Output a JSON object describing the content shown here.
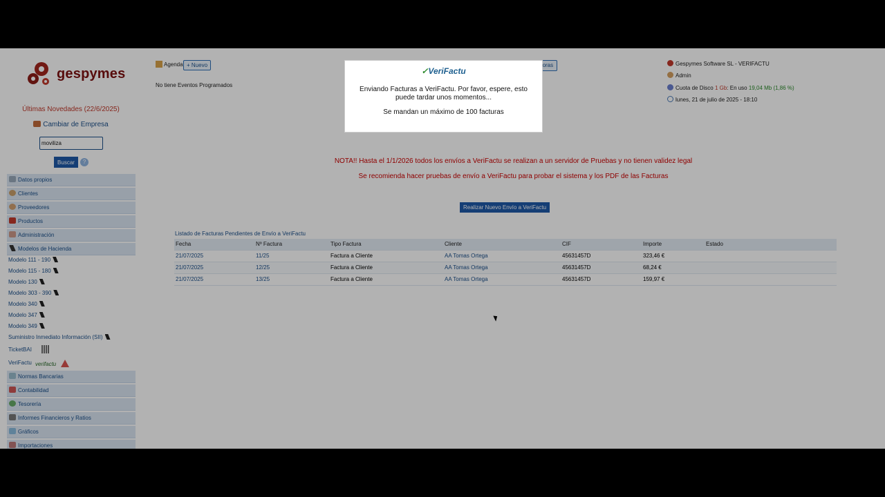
{
  "sidebar": {
    "logo_text": "gespymes",
    "novedades": "Últimas Novedades (22/6/2025)",
    "cambiar_empresa": "Cambiar de Empresa",
    "search_value": "moviliza",
    "buscar_label": "Buscar",
    "help_label": "?",
    "menu": [
      {
        "label": "Datos propios"
      },
      {
        "label": "Clientes"
      },
      {
        "label": "Proveedores"
      },
      {
        "label": "Productos"
      },
      {
        "label": "Administración"
      },
      {
        "label": "Modelos de Hacienda"
      }
    ],
    "modelos": [
      {
        "label": "Modelo 111 - 190"
      },
      {
        "label": "Modelo 115 - 180"
      },
      {
        "label": "Modelo 130"
      },
      {
        "label": "Modelo 303 - 390"
      },
      {
        "label": "Modelo 340"
      },
      {
        "label": "Modelo 347"
      },
      {
        "label": "Modelo 349"
      },
      {
        "label": "Suministro Inmediato Información (SII)"
      }
    ],
    "ticketbai": "TicketBAI",
    "verifactu": "VeriFactu",
    "verifactu_mini": "verifactu",
    "menu2": [
      {
        "label": "Normas Bancarias"
      },
      {
        "label": "Contabilidad"
      },
      {
        "label": "Tesorería"
      },
      {
        "label": "Informes Financieros y Ratios"
      },
      {
        "label": "Gráficos"
      },
      {
        "label": "Importaciones"
      }
    ]
  },
  "header": {
    "agenda": "Agenda",
    "nuevo": "+ Nuevo",
    "no_eventos": "No tiene Eventos Programados",
    "control_horas": "o de Horas",
    "company": "Gespymes Software SL - VERIFACTU",
    "user": "Admin",
    "disk_label": "Cuota de Disco",
    "disk_quota": "1 Gb",
    "disk_use_label": ": En uso",
    "disk_used": "19,04 Mb (1,86 %)",
    "date": "lunes, 21 de julio de 2025 - 18:10"
  },
  "main": {
    "nota": "NOTA!! Hasta el 1/1/2026 todos los envíos a VeriFactu se realizan a un servidor de Pruebas y no tienen validez legal",
    "recomienda": "Se recomienda hacer pruebas de envío a VeriFactu para probar el sistema y los PDF de las Facturas",
    "btn_envio": "Realizar Nuevo Envío a VeriFactu",
    "table_title": "Listado de Facturas Pendientes de Envío a VeriFactu",
    "columns": [
      "Fecha",
      "Nº Factura",
      "Tipo Factura",
      "Cliente",
      "CIF",
      "Importe",
      "Estado"
    ],
    "rows": [
      {
        "fecha": "21/07/2025",
        "num": "11/25",
        "tipo": "Factura a Cliente",
        "cliente": "AA Tomas Ortega",
        "cif": "45631457D",
        "importe": "323,46 €",
        "estado": ""
      },
      {
        "fecha": "21/07/2025",
        "num": "12/25",
        "tipo": "Factura a Cliente",
        "cliente": "AA Tomas Ortega",
        "cif": "45631457D",
        "importe": "68,24 €",
        "estado": ""
      },
      {
        "fecha": "21/07/2025",
        "num": "13/25",
        "tipo": "Factura a Cliente",
        "cliente": "AA Tomas Ortega",
        "cif": "45631457D",
        "importe": "159,97 €",
        "estado": ""
      }
    ]
  },
  "modal": {
    "logo": "VeriFactu",
    "message": "Enviando Facturas a VeriFactu. Por favor, espere, esto puede tardar unos momentos...",
    "max_note": "Se mandan un máximo de 100 facturas"
  },
  "colors": {
    "link": "#1b4f8a",
    "warning_text": "#cc0000",
    "primary_button": "#1f5aa8",
    "overlay": "rgba(0,0,0,0.30)"
  }
}
